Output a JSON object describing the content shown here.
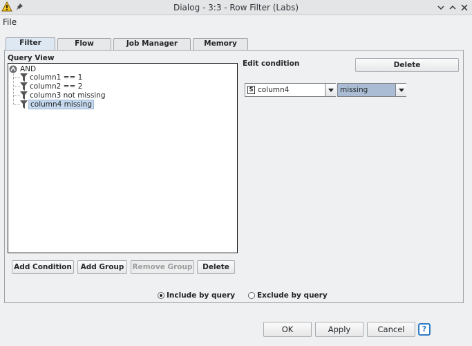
{
  "window": {
    "title": "Dialog - 3:3 - Row Filter (Labs)",
    "accent": "#f3c623"
  },
  "menu": {
    "file": "File"
  },
  "tabs": [
    {
      "label": "Filter Criteria",
      "active": true
    },
    {
      "label": "Flow Variables",
      "active": false
    },
    {
      "label": "Job Manager Selection",
      "active": false
    },
    {
      "label": "Memory Policy",
      "active": false
    }
  ],
  "query_view": {
    "label": "Query View",
    "root": "AND",
    "conditions": [
      {
        "label": "column1 == 1",
        "selected": false
      },
      {
        "label": "column2 == 2",
        "selected": false
      },
      {
        "label": "column3 not missing",
        "selected": false
      },
      {
        "label": "column4 missing",
        "selected": true
      }
    ],
    "buttons": {
      "add_condition": "Add Condition",
      "add_group": "Add Group",
      "remove_group": "Remove Group",
      "delete": "Delete"
    }
  },
  "edit_condition": {
    "label": "Edit condition",
    "delete": "Delete",
    "column_type_badge": "S",
    "column_value": "column4",
    "operator_value": "missing"
  },
  "mode": {
    "include": "Include by query",
    "exclude": "Exclude by query",
    "selected": "include"
  },
  "footer": {
    "ok": "OK",
    "apply": "Apply",
    "cancel": "Cancel",
    "help": "?"
  }
}
